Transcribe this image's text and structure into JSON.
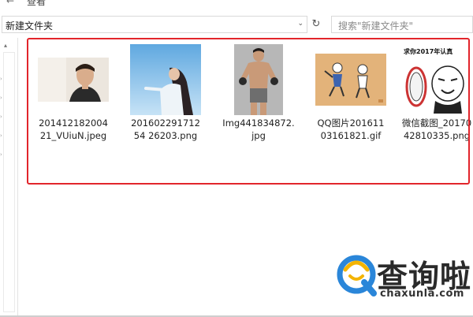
{
  "ribbon": {
    "back_arrow": "←",
    "tab_label": "查看"
  },
  "address": {
    "path": "新建文件夹",
    "dropdown_glyph": "⌄",
    "refresh_glyph": "↻"
  },
  "search": {
    "placeholder": "搜索\"新建文件夹\""
  },
  "nav": {
    "scroll_up_glyph": "▴",
    "chevron_glyph": "›"
  },
  "files": [
    {
      "name": "20141218200421_VUiuN.jpeg",
      "thumb": "man-portrait-photo"
    },
    {
      "name": "20160229171254 26203.png",
      "thumb": "girl-sky-photo"
    },
    {
      "name": "Img441834872.jpg",
      "thumb": "athlete-photo"
    },
    {
      "name": "QQ图片20161103161821.gif",
      "thumb": "cartoon-gif"
    },
    {
      "name": "微信截图_2017042810335.png",
      "thumb": "meme-screenshot"
    }
  ],
  "meme_caption": "求你2017年认真",
  "logo": {
    "brand_text": "查询啦",
    "domain": "chaxunla.com",
    "accent": "#2a86d9"
  },
  "colors": {
    "highlight": "#e2252b"
  }
}
